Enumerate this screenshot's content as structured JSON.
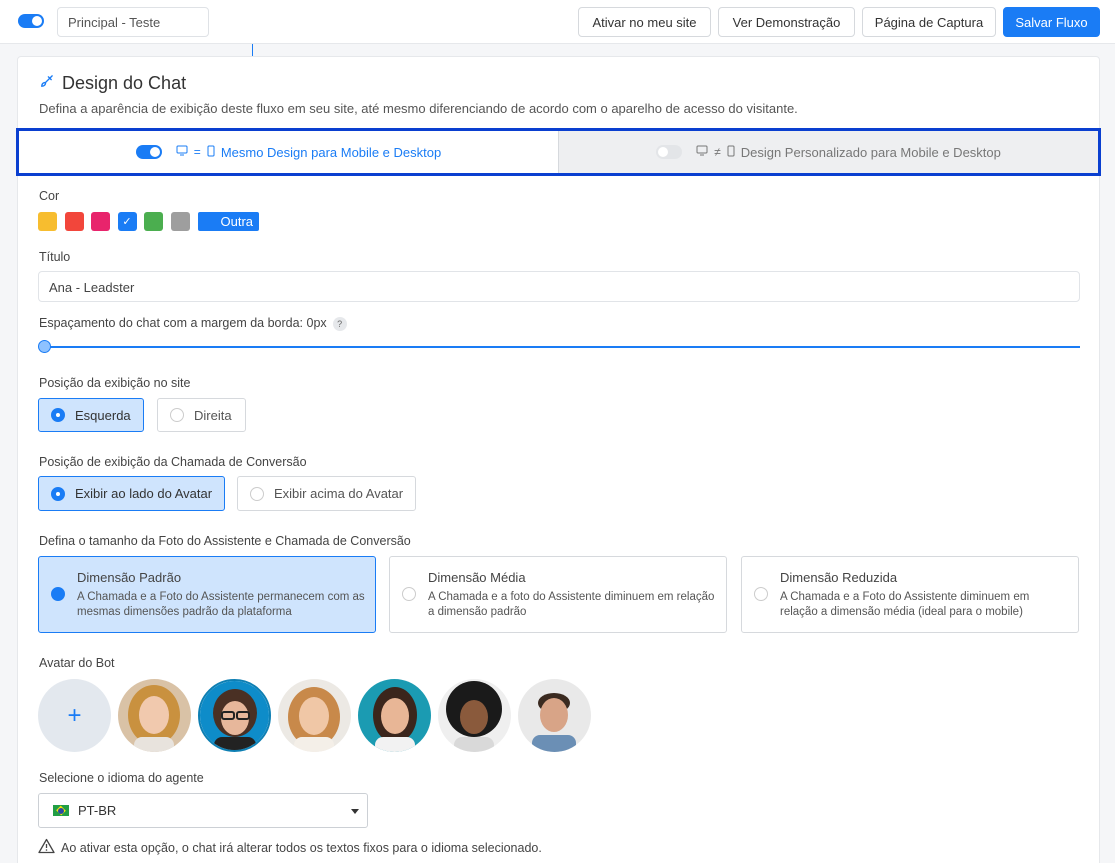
{
  "header": {
    "flow_name": "Principal - Teste",
    "activate_label": "Ativar no meu site",
    "demo_label": "Ver Demonstração",
    "capture_label": "Página de Captura",
    "save_label": "Salvar Fluxo"
  },
  "design": {
    "title": "Design do Chat",
    "subtitle": "Defina a aparência de exibição deste fluxo em seu site, até mesmo diferenciando de acordo com o aparelho de acesso do visitante.",
    "same_design_label": "Mesmo Design para Mobile e Desktop",
    "custom_design_label": "Design Personalizado para Mobile e Desktop",
    "same_design_on": true,
    "custom_design_on": false
  },
  "color": {
    "label": "Cor",
    "swatches": [
      "#f7bd2f",
      "#f2463b",
      "#e8246c",
      "#1a7cf5",
      "#4bae4f",
      "#9e9e9e"
    ],
    "selected_index": 3,
    "other_label": "Outra"
  },
  "title_field": {
    "label": "Título",
    "value": "Ana - Leadster"
  },
  "spacing": {
    "label": "Espaçamento do chat com a margem da borda: 0px",
    "help": "?",
    "value": 0
  },
  "position": {
    "label": "Posição da exibição no site",
    "options": [
      "Esquerda",
      "Direita"
    ],
    "selected": "Esquerda"
  },
  "call_position": {
    "label": "Posição de exibição da Chamada de Conversão",
    "options": [
      "Exibir ao lado do Avatar",
      "Exibir acima do Avatar"
    ],
    "selected": "Exibir ao lado do Avatar"
  },
  "photo_size": {
    "label": "Defina o tamanho da Foto do Assistente e Chamada de Conversão",
    "options": [
      {
        "title": "Dimensão Padrão",
        "desc": "A Chamada e a Foto do Assistente permanecem com as mesmas dimensões padrão da plataforma"
      },
      {
        "title": "Dimensão Média",
        "desc": "A Chamada e a foto do Assistente diminuem em relação a dimensão padrão"
      },
      {
        "title": "Dimensão Reduzida",
        "desc": "A Chamada e a Foto do Assistente diminuem em relação a dimensão média (ideal para o mobile)"
      }
    ],
    "selected": "Dimensão Padrão"
  },
  "avatar": {
    "label": "Avatar do Bot",
    "add_symbol": "+"
  },
  "language": {
    "label": "Selecione o idioma do agente",
    "selected": "PT-BR",
    "warning": "Ao ativar esta opção, o chat irá alterar todos os textos fixos para o idioma selecionado."
  }
}
